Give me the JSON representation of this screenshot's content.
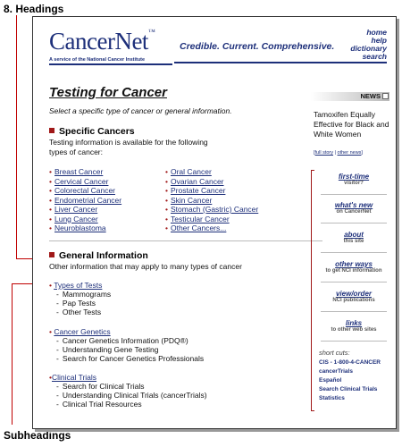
{
  "callouts": {
    "top_label": "8. Headings",
    "bottom_label": "Subheadings"
  },
  "site": {
    "logo": "CancerNet",
    "logo_tm": "™",
    "logo_tagline": "A service of the National Cancer Institute",
    "tagline": "Credible. Current. Comprehensive.",
    "top_links": [
      "home",
      "help",
      "dictionary",
      "search"
    ]
  },
  "page": {
    "title": "Testing for Cancer",
    "intro": "Select a specific type of cancer or general information."
  },
  "specific": {
    "heading": "Specific Cancers",
    "text": "Testing information is available for the following types of cancer:",
    "col1": [
      "Breast Cancer",
      "Cervical Cancer",
      "Colorectal Cancer",
      "Endometrial Cancer",
      "Liver Cancer",
      "Lung Cancer",
      "Neuroblastoma"
    ],
    "col2": [
      "Oral Cancer",
      "Ovarian Cancer",
      "Prostate Cancer",
      "Skin Cancer",
      "Stomach (Gastric) Cancer",
      "Testicular Cancer",
      "Other Cancers..."
    ]
  },
  "general": {
    "heading": "General Information",
    "text": "Other information that may apply to many types of cancer",
    "groups": [
      {
        "link": "Types of Tests",
        "items": [
          "Mammograms",
          "Pap Tests",
          "Other Tests"
        ]
      },
      {
        "link": "Cancer Genetics",
        "items": [
          "Cancer Genetics Information (PDQ®)",
          "Understanding Gene Testing",
          "Search for Cancer Genetics Professionals"
        ]
      },
      {
        "link": "Clinical Trials",
        "items": [
          "Search for Clinical Trials",
          "Understanding Clinical Trials (cancerTrials)",
          "Clinical Trial Resources"
        ]
      }
    ]
  },
  "news": {
    "label": "NEWS",
    "headline": "Tamoxifen Equally Effective for Black and White Women",
    "link_full": "full story",
    "link_other": "other news"
  },
  "nav": [
    {
      "main": "first-time",
      "sub": "visitor?"
    },
    {
      "main": "what's new",
      "sub": "on CancerNet"
    },
    {
      "main": "about",
      "sub": "this site"
    },
    {
      "main": "other ways",
      "sub": "to get NCI information"
    },
    {
      "main": "view/order",
      "sub": "NCI publications"
    },
    {
      "main": "links",
      "sub": "to other web sites"
    }
  ],
  "shortcuts": {
    "title": "short cuts:",
    "items": [
      "CIS - 1-800-4-CANCER",
      "cancerTrials",
      "Español",
      "Search Clinical Trials",
      "Statistics"
    ]
  },
  "colors": {
    "brand_blue": "#1d2f7a",
    "accent_red": "#a01818",
    "callout_red": "#c00000"
  }
}
